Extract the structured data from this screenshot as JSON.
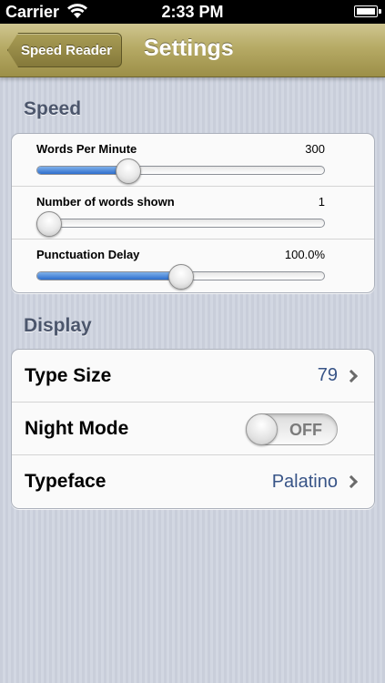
{
  "status_bar": {
    "carrier": "Carrier",
    "time": "2:33 PM"
  },
  "nav": {
    "back_label": "Speed Reader",
    "title": "Settings"
  },
  "speed_section": {
    "header": "Speed",
    "sliders": [
      {
        "label": "Words Per Minute",
        "value": "300",
        "fraction": 0.3
      },
      {
        "label": "Number of words shown",
        "value": "1",
        "fraction": 0.0
      },
      {
        "label": "Punctuation Delay",
        "value": "100.0%",
        "fraction": 0.5
      }
    ]
  },
  "display_section": {
    "header": "Display",
    "type_size": {
      "label": "Type Size",
      "value": "79"
    },
    "night_mode": {
      "label": "Night Mode",
      "state": "OFF"
    },
    "typeface": {
      "label": "Typeface",
      "value": "Palatino"
    }
  },
  "colors": {
    "accent_value": "#385487",
    "nav_bar": "#b6aa65",
    "slider_fill": "#2e6fcd"
  }
}
